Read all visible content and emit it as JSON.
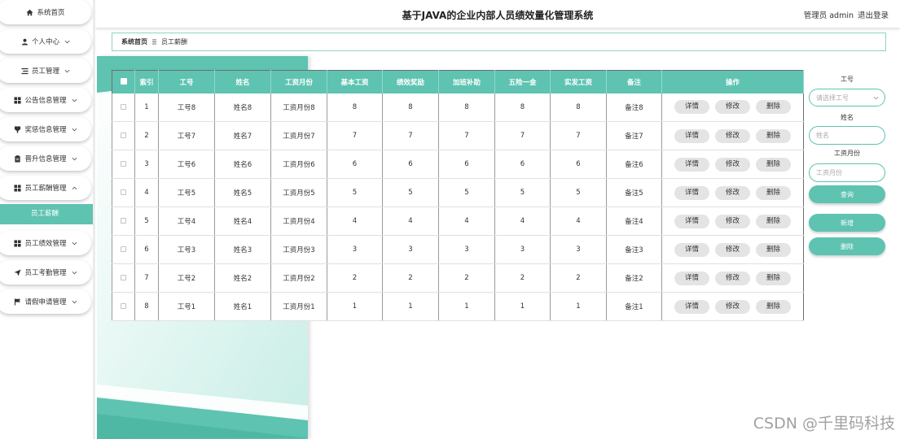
{
  "header": {
    "title": "基于JAVA的企业内部人员绩效量化管理系统",
    "user_label": "管理员 admin",
    "logout_label": "退出登录"
  },
  "sidebar": {
    "items": [
      {
        "label": "系统首页",
        "icon": "home-icon",
        "chevron": null
      },
      {
        "label": "个人中心",
        "icon": "user-icon",
        "chevron": "chevron-down-icon"
      },
      {
        "label": "员工管理",
        "icon": "list-icon",
        "chevron": "chevron-down-icon"
      },
      {
        "label": "公告信息管理",
        "icon": "grid-icon",
        "chevron": "chevron-down-icon"
      },
      {
        "label": "奖惩信息管理",
        "icon": "badge-icon",
        "chevron": "chevron-down-icon"
      },
      {
        "label": "晋升信息管理",
        "icon": "clipboard-icon",
        "chevron": "chevron-down-icon"
      },
      {
        "label": "员工薪酬管理",
        "icon": "grid-icon",
        "chevron": "chevron-up-icon"
      },
      {
        "label": "员工绩效管理",
        "icon": "grid-icon",
        "chevron": "chevron-down-icon"
      },
      {
        "label": "员工考勤管理",
        "icon": "send-icon",
        "chevron": "chevron-down-icon"
      },
      {
        "label": "请假申请管理",
        "icon": "flag-icon",
        "chevron": "chevron-down-icon"
      }
    ],
    "submenu": [
      {
        "label": "员工薪酬",
        "active": true
      }
    ]
  },
  "breadcrumb": {
    "home": "系统首页",
    "separator_icon": "breadcrumb-separator-icon",
    "current": "员工薪酬"
  },
  "table": {
    "headers": [
      "索引",
      "工号",
      "姓名",
      "工资月份",
      "基本工资",
      "绩效奖励",
      "加班补助",
      "五险一金",
      "实发工资",
      "备注",
      "操作"
    ],
    "rows": [
      {
        "index": 1,
        "emp_no": "工号8",
        "name": "姓名8",
        "month": "工资月份8",
        "base_salary": 8,
        "performance_bonus": 8,
        "overtime_allowance": 8,
        "insurance_fund": 8,
        "net_salary": 8,
        "note": "备注8"
      },
      {
        "index": 2,
        "emp_no": "工号7",
        "name": "姓名7",
        "month": "工资月份7",
        "base_salary": 7,
        "performance_bonus": 7,
        "overtime_allowance": 7,
        "insurance_fund": 7,
        "net_salary": 7,
        "note": "备注7"
      },
      {
        "index": 3,
        "emp_no": "工号6",
        "name": "姓名6",
        "month": "工资月份6",
        "base_salary": 6,
        "performance_bonus": 6,
        "overtime_allowance": 6,
        "insurance_fund": 6,
        "net_salary": 6,
        "note": "备注6"
      },
      {
        "index": 4,
        "emp_no": "工号5",
        "name": "姓名5",
        "month": "工资月份5",
        "base_salary": 5,
        "performance_bonus": 5,
        "overtime_allowance": 5,
        "insurance_fund": 5,
        "net_salary": 5,
        "note": "备注5"
      },
      {
        "index": 5,
        "emp_no": "工号4",
        "name": "姓名4",
        "month": "工资月份4",
        "base_salary": 4,
        "performance_bonus": 4,
        "overtime_allowance": 4,
        "insurance_fund": 4,
        "net_salary": 4,
        "note": "备注4"
      },
      {
        "index": 6,
        "emp_no": "工号3",
        "name": "姓名3",
        "month": "工资月份3",
        "base_salary": 3,
        "performance_bonus": 3,
        "overtime_allowance": 3,
        "insurance_fund": 3,
        "net_salary": 3,
        "note": "备注3"
      },
      {
        "index": 7,
        "emp_no": "工号2",
        "name": "姓名2",
        "month": "工资月份2",
        "base_salary": 2,
        "performance_bonus": 2,
        "overtime_allowance": 2,
        "insurance_fund": 2,
        "net_salary": 2,
        "note": "备注2"
      },
      {
        "index": 8,
        "emp_no": "工号1",
        "name": "姓名1",
        "month": "工资月份1",
        "base_salary": 1,
        "performance_bonus": 1,
        "overtime_allowance": 1,
        "insurance_fund": 1,
        "net_salary": 1,
        "note": "备注1"
      }
    ],
    "actions": {
      "detail": "详情",
      "edit": "修改",
      "delete": "删除"
    }
  },
  "search": {
    "emp_no_label": "工号",
    "emp_no_placeholder": "请选择工号",
    "name_label": "姓名",
    "name_placeholder": "姓名",
    "month_label": "工资月份",
    "month_placeholder": "工资月份",
    "query_label": "查询",
    "add_label": "新增",
    "delete_label": "删除"
  },
  "watermark": "CSDN @千里码科技",
  "colors": {
    "accent": "#5ec3b1",
    "button_gray": "#e4e4e4",
    "text": "#333333"
  }
}
